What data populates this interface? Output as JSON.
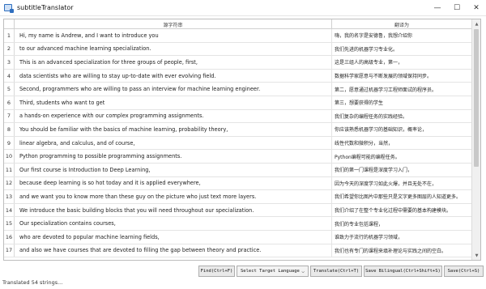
{
  "window": {
    "title": "subtitleTranslator",
    "minimize": "—",
    "maximize": "☐",
    "close": "✕"
  },
  "grid": {
    "columns": {
      "source": "源字符串",
      "target": "翻译为"
    },
    "rows": [
      {
        "num": "1",
        "source": "Hi, my name is Andrew, and I want to introduce you",
        "target": "嗨，我的名字是安德鲁，我想介绍你"
      },
      {
        "num": "2",
        "source": "to our advanced machine learning specialization.",
        "target": "我们先进的机器学习专业化。"
      },
      {
        "num": "3",
        "source": "This is an advanced specialization for three groups of people, first,",
        "target": "这是三组人的高级专业，第一，"
      },
      {
        "num": "4",
        "source": "data scientists who are willing to stay up-to-date with ever evolving field.",
        "target": "数据科学家愿意与不断发展的领域保持同步。"
      },
      {
        "num": "5",
        "source": "Second, programmers who are willing to pass an interview for machine learning engineer.",
        "target": "第二，愿意通过机器学习工程师面试的程序员。"
      },
      {
        "num": "6",
        "source": "Third, students who want to get",
        "target": "第三，想要获得的学生"
      },
      {
        "num": "7",
        "source": "a hands-on experience with our complex programming assignments.",
        "target": "我们复杂的编程任务的实践经验。"
      },
      {
        "num": "8",
        "source": "You should be familiar with the basics of machine learning, probability theory,",
        "target": "你应该熟悉机器学习的基础知识，概率论，"
      },
      {
        "num": "9",
        "source": "linear algebra, and calculus, and of course,",
        "target": "线性代数和微积分，当然，"
      },
      {
        "num": "10",
        "source": "Python programming to possible programming assignments.",
        "target": "Python编程可能的编程任务。"
      },
      {
        "num": "11",
        "source": "Our first course is Introduction to Deep Learning,",
        "target": "我们的第一门课程是深度学习入门，"
      },
      {
        "num": "12",
        "source": "because deep learning is so hot today and it is applied everywhere,",
        "target": "因为今天的深度学习如此火爆，并且无处不在，"
      },
      {
        "num": "13",
        "source": "and we want you to know more than these guy on the picture who just text more layers.",
        "target": "我们希望你比图片中那些只是文字更多图层的人知道更多。"
      },
      {
        "num": "14",
        "source": "We introduce the basic building blocks that you will need throughout our specialization.",
        "target": "我们介绍了在整个专业化过程中需要的基本构建模块。"
      },
      {
        "num": "15",
        "source": "Our specialization contains courses,",
        "target": "我们的专业包括课程，"
      },
      {
        "num": "16",
        "source": "who are devoted to popular machine learning fields,",
        "target": "谁致力于流行的机器学习领域，"
      },
      {
        "num": "17",
        "source": "and also we have courses that are devoted to filling the gap between theory and practice.",
        "target": "我们也有专门的课程来填补理论与实践之间的空白。"
      }
    ]
  },
  "toolbar": {
    "find": "Find(Ctrl+F)",
    "language_select": "Select Target Language",
    "translate": "Translate(Ctrl+T)",
    "save_bilingual": "Save Bilingual(Ctrl+Shift+S)",
    "save": "Save(Ctrl+S)"
  },
  "status": "Translated 54 strings..."
}
